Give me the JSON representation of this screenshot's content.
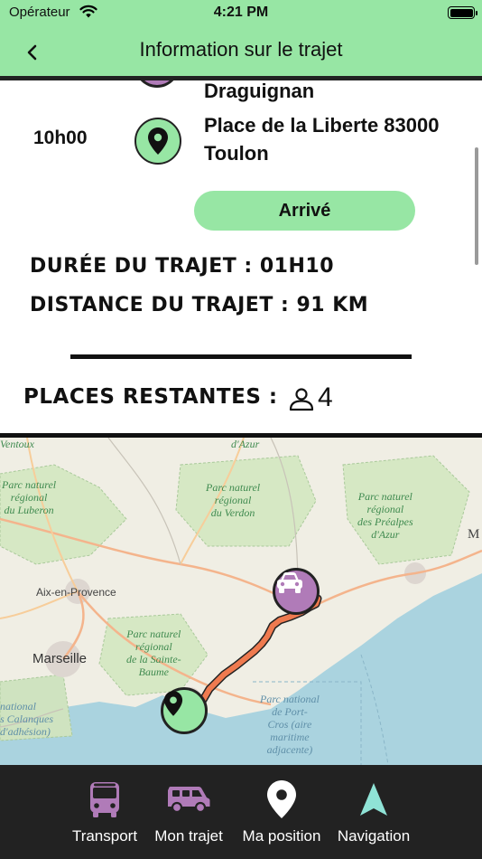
{
  "status_bar": {
    "carrier": "Opérateur",
    "time": "4:21 PM"
  },
  "header": {
    "title": "Information sur le trajet"
  },
  "trip": {
    "departure_city": "Draguignan",
    "arrival_time": "10h00",
    "arrival_address_line1": "Place de la Liberte 83000",
    "arrival_address_line2": "Toulon",
    "arrive_label": "Arrivé",
    "duration": "Durée du trajet : 01H10",
    "distance": "Distance du trajet : 91 KM",
    "places_label": "Places restantes :",
    "places_count": "4"
  },
  "map": {
    "labels": {
      "dazur": "d'Azur",
      "luberon": "Parc naturel\nrégional\ndu Luberon",
      "verdon": "Parc naturel\nrégional\ndu Verdon",
      "prealpes": "Parc naturel\nrégional\ndes Préalpes\nd'Azur",
      "aix": "Aix-en-Provence",
      "marseille": "Marseille",
      "sainte_baume": "Parc naturel\nrégional\nde la Sainte-\nBaume",
      "calanques": "national\ns Calanques\nd'adhésion)",
      "portcros": "Parc national\nde Port-\nCros (aire\nmaritime\nadjacente)",
      "ventoux": "Ventoux",
      "m": "M"
    }
  },
  "tabs": [
    {
      "label": "Transport",
      "icon": "bus-icon"
    },
    {
      "label": "Mon trajet",
      "icon": "van-icon"
    },
    {
      "label": "Ma position",
      "icon": "location-pin-icon"
    },
    {
      "label": "Navigation",
      "icon": "navigation-arrow-icon"
    }
  ],
  "colors": {
    "header_green": "#97e6a4",
    "purple": "#b07bb8",
    "route_orange": "#ef7a4f",
    "tabbar_bg": "#222222",
    "tab_bus": "#b07bb8",
    "tab_van": "#b07bb8",
    "tab_pin": "#ffffff",
    "tab_nav": "#8fe3d6"
  }
}
